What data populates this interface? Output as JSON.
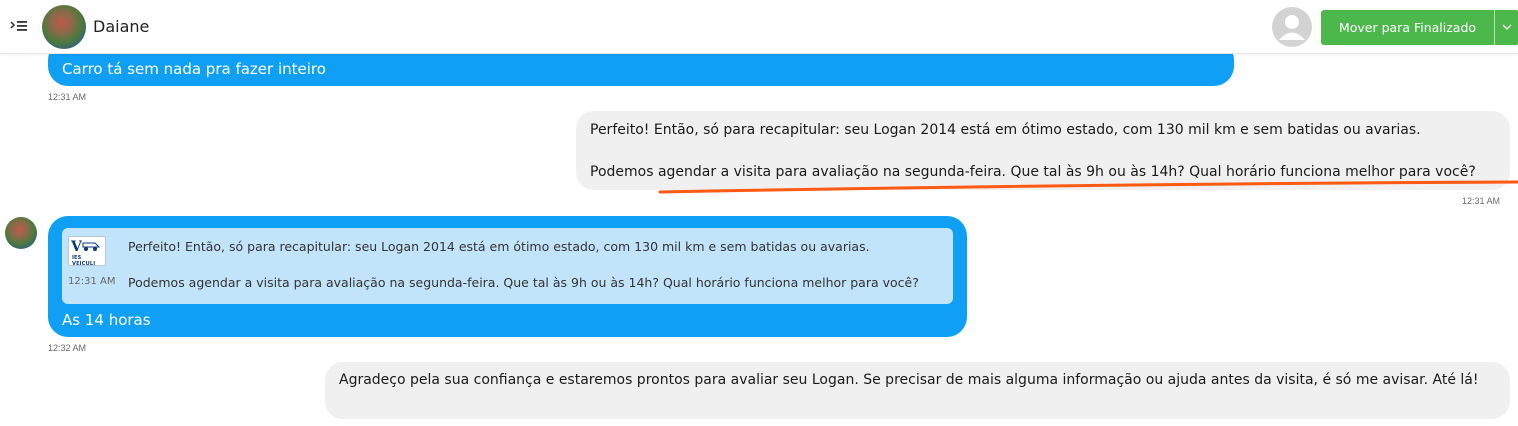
{
  "header": {
    "contact_name": "Daiane",
    "move_button_label": "Mover para Finalizado",
    "icons": {
      "menu": "menu-collapse-icon",
      "agent": "user-placeholder-icon",
      "dropdown": "chevron-down-icon"
    },
    "colors": {
      "move_button": "#4cb84c",
      "incoming_bubble": "#0fa0f5",
      "outgoing_bubble": "#f0f0f0",
      "annotation": "#ff5a14"
    }
  },
  "messages": [
    {
      "direction": "incoming",
      "text": "Carro tá sem nada pra fazer inteiro",
      "time": "12:31 AM"
    },
    {
      "direction": "outgoing",
      "line1": "Perfeito! Então, só para recapitular: seu Logan 2014 está em ótimo estado, com 130 mil km e sem batidas ou avarias.",
      "line2": "Podemos agendar a visita para avaliação na segunda-feira. Que tal às 9h ou às 14h? Qual horário funciona melhor para você?",
      "time": "12:31 AM"
    },
    {
      "direction": "incoming",
      "quoted": {
        "logo_text": "IES VEICULI",
        "line1": "Perfeito! Então, só para recapitular: seu Logan 2014 está em ótimo estado, com 130 mil km e sem batidas ou avarias.",
        "line2": "Podemos agendar a visita para avaliação na segunda-feira. Que tal às 9h ou às 14h? Qual horário funciona melhor para você?",
        "time": "12:31 AM"
      },
      "text": "As 14 horas",
      "time": "12:32 AM"
    },
    {
      "direction": "outgoing",
      "text": "Agradeço pela sua confiança e estaremos prontos para avaliar seu Logan. Se precisar de mais alguma informação ou ajuda antes da visita, é só me avisar. Até lá!"
    }
  ]
}
